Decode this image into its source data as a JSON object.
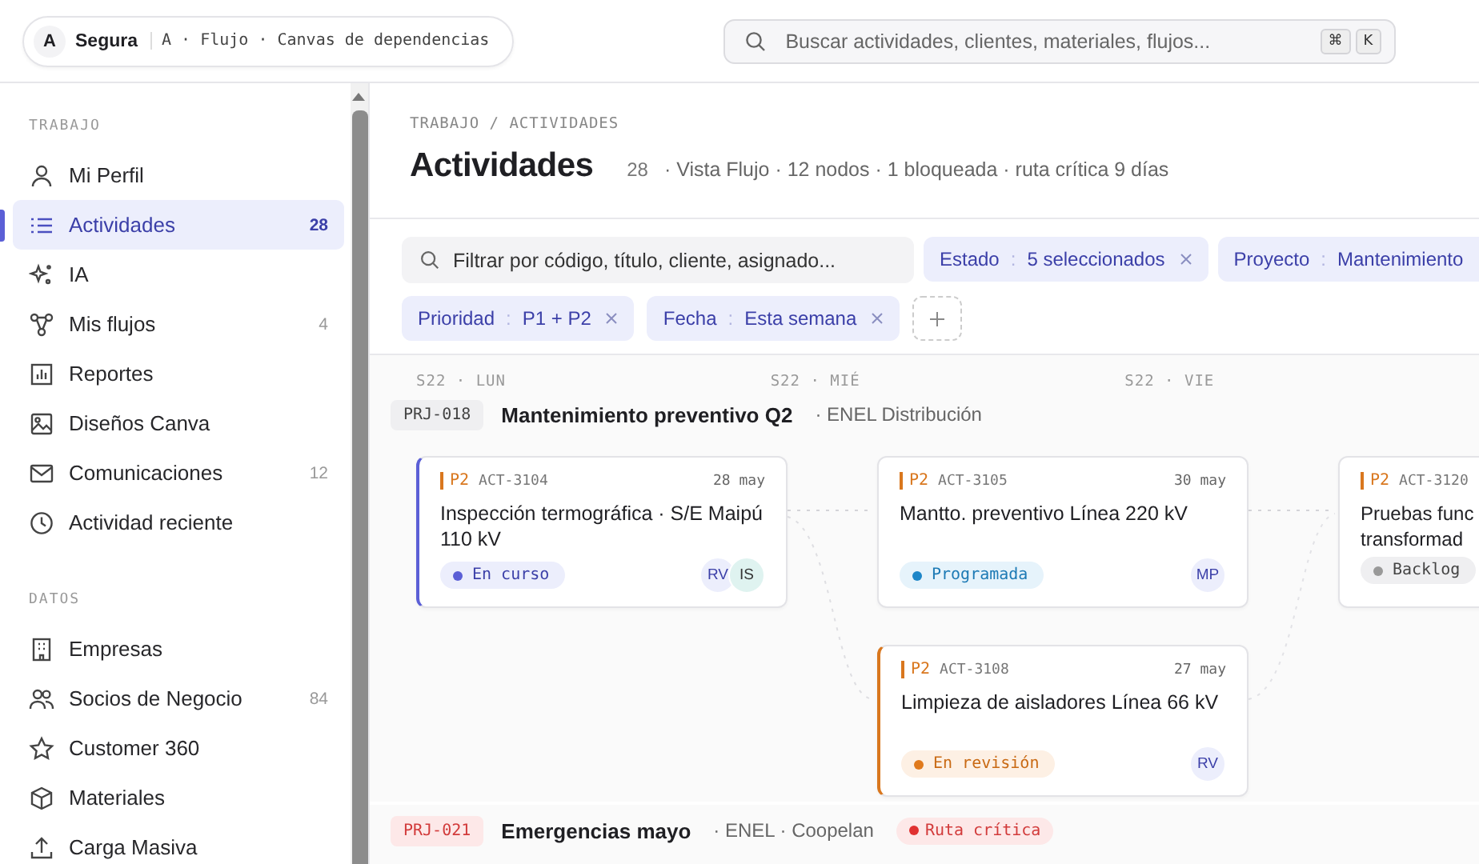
{
  "topbar": {
    "workspace": {
      "initial": "A",
      "name": "Segura",
      "path": "A · Flujo · Canvas de dependencias"
    },
    "search": {
      "placeholder": "Buscar actividades, clientes, materiales, flujos...",
      "keys": [
        "⌘",
        "K"
      ]
    }
  },
  "sidebar": {
    "sections": [
      {
        "title": "TRABAJO",
        "items": [
          {
            "label": "Mi Perfil",
            "selected": false
          },
          {
            "label": "Actividades",
            "count": "28",
            "selected": true
          },
          {
            "label": "IA",
            "selected": false
          },
          {
            "label": "Mis flujos",
            "count": "4",
            "selected": false
          },
          {
            "label": "Reportes",
            "selected": false
          },
          {
            "label": "Diseños Canva",
            "selected": false
          },
          {
            "label": "Comunicaciones",
            "count": "12",
            "selected": false
          },
          {
            "label": "Actividad reciente",
            "selected": false
          }
        ]
      },
      {
        "title": "DATOS",
        "items": [
          {
            "label": "Empresas",
            "selected": false
          },
          {
            "label": "Socios de Negocio",
            "count": "84",
            "selected": false
          },
          {
            "label": "Customer 360",
            "selected": false
          },
          {
            "label": "Materiales",
            "selected": false
          },
          {
            "label": "Carga Masiva",
            "selected": false
          }
        ]
      }
    ]
  },
  "header": {
    "breadcrumb": "TRABAJO / ACTIVIDADES",
    "title": "Actividades",
    "count": "28",
    "meta": "· Vista Flujo · 12 nodos · 1 bloqueada · ruta crítica 9 días"
  },
  "filters": {
    "placeholder": "Filtrar por código, título, cliente, asignado...",
    "chips": [
      {
        "label": "Estado",
        "separator": ":",
        "value": "5 seleccionados",
        "removable": true
      },
      {
        "label": "Proyecto",
        "separator": ":",
        "value": "Mantenimiento",
        "removable": false
      },
      {
        "label": "Prioridad",
        "separator": ":",
        "value": "P1 + P2",
        "removable": true
      },
      {
        "label": "Fecha",
        "separator": ":",
        "value": "Esta semana",
        "removable": true
      }
    ]
  },
  "canvas": {
    "days": [
      "S22 · LUN",
      "S22 · MIÉ",
      "S22 · VIE"
    ],
    "lanes": [
      {
        "code": "PRJ-018",
        "title": "Mantenimiento preventivo Q2",
        "client": "· ENEL Distribución",
        "critical": false,
        "columns": [
          [
            {
              "priority": "P2",
              "id": "ACT-3104",
              "date": "28 may",
              "title": "Inspección termográfica · S/E Maipú 110 kV",
              "status": {
                "label": "En curso",
                "kind": "in_progress"
              },
              "assignees": [
                "RV",
                "IS"
              ],
              "color": "#5b5fd6"
            }
          ],
          [
            {
              "priority": "P2",
              "id": "ACT-3105",
              "date": "30 may",
              "title": "Mantto. preventivo Línea 220 kV",
              "status": {
                "label": "Programada",
                "kind": "scheduled"
              },
              "assignees": [
                "MP"
              ]
            },
            {
              "priority": "P2",
              "id": "ACT-3108",
              "date": "27 may",
              "title": "Limpieza de aisladores Línea 66 kV",
              "status": {
                "label": "En revisión",
                "kind": "review"
              },
              "assignees": [
                "RV"
              ],
              "color": "#d9771e"
            }
          ],
          [
            {
              "priority": "P2",
              "id": "ACT-3120",
              "title": "Pruebas func transformad",
              "status": {
                "label": "Backlog",
                "kind": "backlog"
              }
            }
          ]
        ]
      },
      {
        "code": "PRJ-021",
        "title": "Emergencias mayo",
        "client": "· ENEL · Coopelan",
        "critical": true,
        "tag": "Ruta crítica"
      }
    ]
  }
}
